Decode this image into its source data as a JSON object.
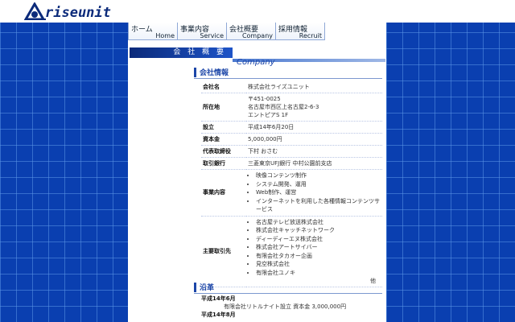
{
  "logo": {
    "text": "riseunit"
  },
  "nav": [
    {
      "jp": "ホーム",
      "en": "Home"
    },
    {
      "jp": "事業内容",
      "en": "Service"
    },
    {
      "jp": "会社概要",
      "en": "Company"
    },
    {
      "jp": "採用情報",
      "en": "Recruit"
    }
  ],
  "banner": {
    "jp": "会 社 概 要",
    "en": "Company"
  },
  "section1": {
    "title": "会社情報"
  },
  "info": {
    "company_label": "会社名",
    "company_value": "株式会社ライズユニット",
    "address_label": "所在地",
    "address_lines": [
      "〒451-0025",
      "名古屋市西区上名古屋2-6-3",
      "エントピアS 1F"
    ],
    "established_label": "設立",
    "established_value": "平成14年6月20日",
    "capital_label": "資本金",
    "capital_value": "5,000,000円",
    "ceo_label": "代表取締役",
    "ceo_value": "下村 おさむ",
    "bank_label": "取引銀行",
    "bank_value": "三菱東京UFJ銀行 中村公園前支店",
    "business_label": "事業内容",
    "business_items": [
      "映像コンテンツ制作",
      "システム開発、運用",
      "Web制作、運営",
      "インターネットを利用した各種情報コンテンツサービス"
    ],
    "clients_label": "主要取引先",
    "clients_items": [
      "名古屋テレビ放送株式会社",
      "株式会社キャッチネットワーク",
      "ディーディーエヌ株式会社",
      "株式会社アートサイバー",
      "有限会社タカオー企画",
      "見空株式会社",
      "有限会社ユノキ"
    ],
    "clients_etc": "他"
  },
  "section2": {
    "title": "沿革"
  },
  "history": [
    {
      "year": "平成14年6月",
      "text": "有限会社リトルナイト設立 資本金 3,000,000円"
    },
    {
      "year": "平成14年8月",
      "text": ""
    }
  ],
  "colors": {
    "background": "#0a3fb0",
    "accent": "#1c46a8"
  }
}
